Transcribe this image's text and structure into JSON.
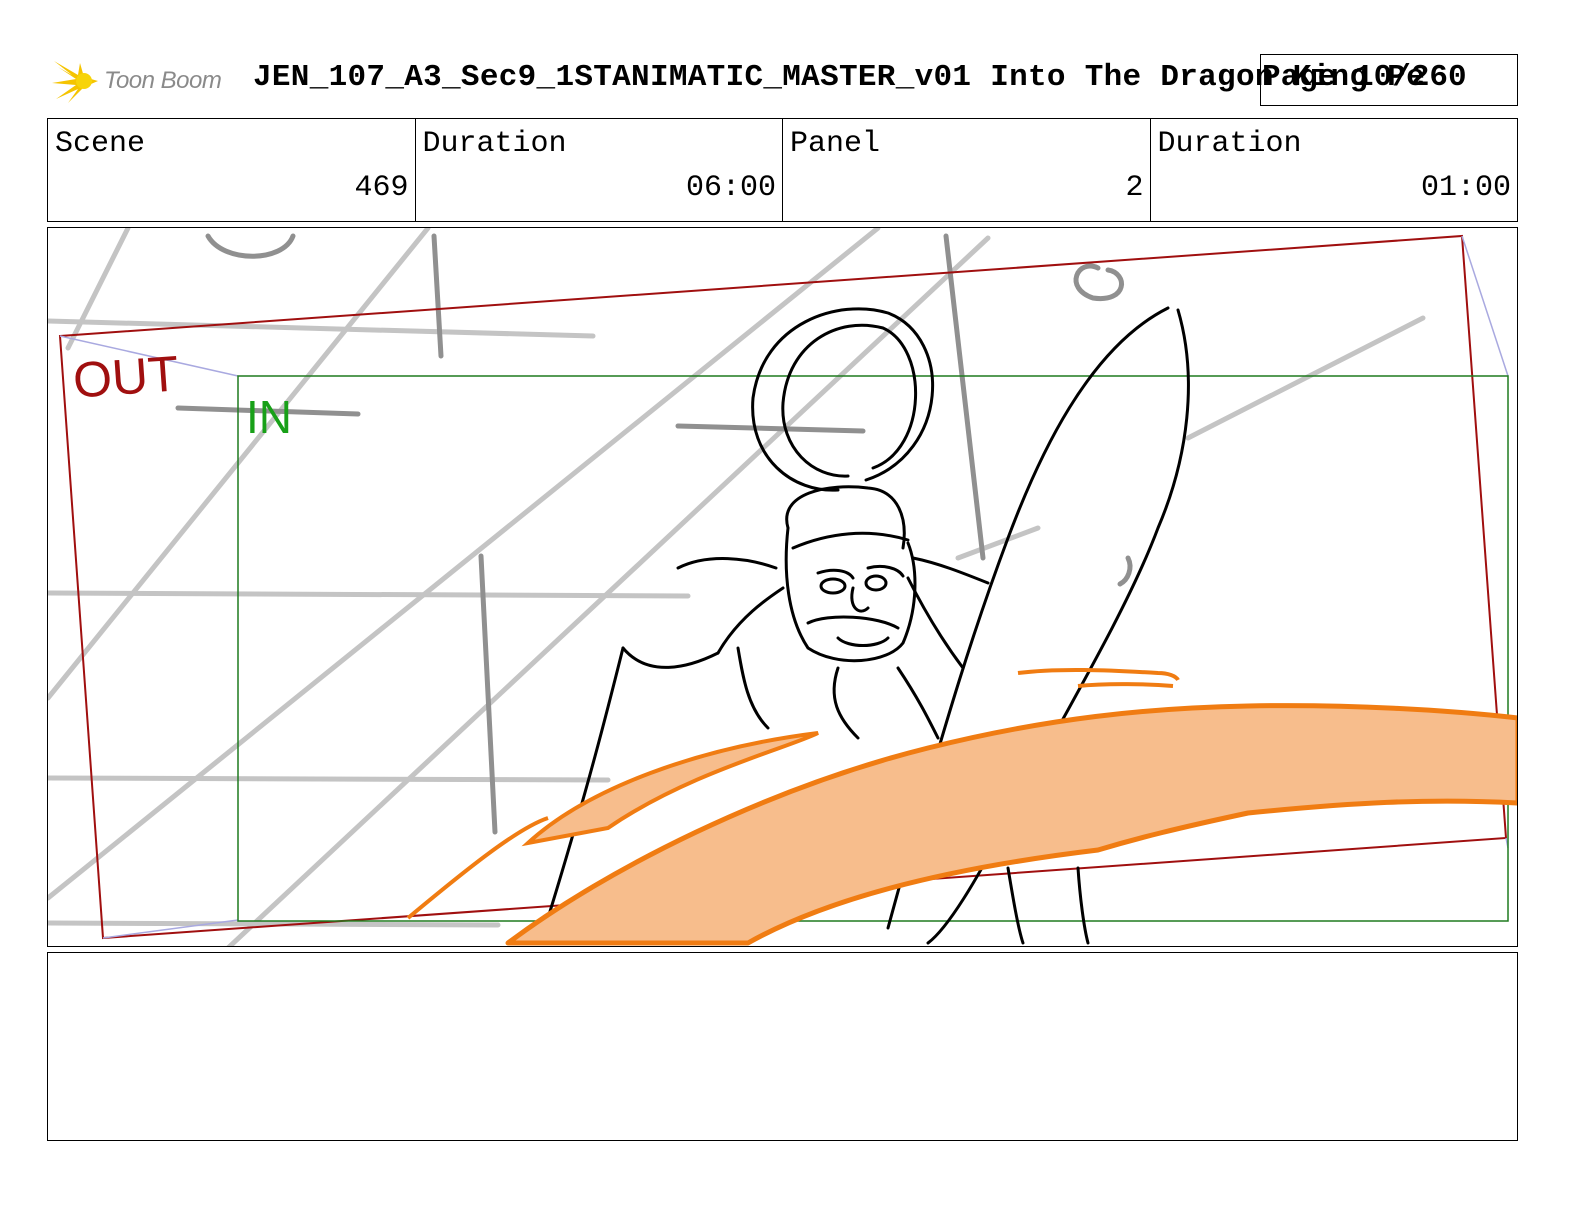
{
  "header": {
    "logo_text": "Toon Boom",
    "title": "JEN_107_A3_Sec9_1STANIMATIC_MASTER_v01  Into The Dragon King Pe",
    "page_label": "Page 10/260"
  },
  "info": {
    "scene_label": "Scene",
    "scene_value": "469",
    "scene_duration_label": "Duration",
    "scene_duration_value": "06:00",
    "panel_label": "Panel",
    "panel_value": "2",
    "panel_duration_label": "Duration",
    "panel_duration_value": "01:00"
  },
  "frame": {
    "out_label": "OUT",
    "in_label": "IN"
  },
  "colors": {
    "out_frame": "#a00f0f",
    "in_frame": "#1f7a1f",
    "sketch_gray": "#c0c0c0",
    "orange": "#f07c12",
    "orange_fill": "#f7bd8c"
  },
  "notes": ""
}
